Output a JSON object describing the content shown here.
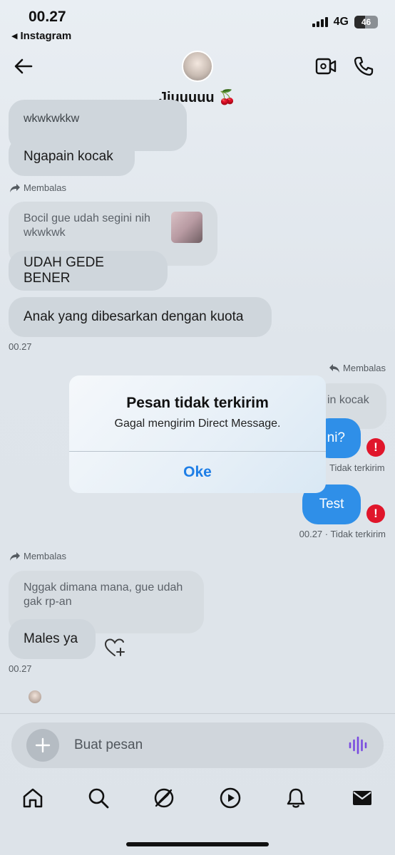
{
  "status_bar": {
    "time": "00.27",
    "back_app": "Instagram",
    "network": "4G",
    "battery": "46",
    "battery_level": 0.46
  },
  "header": {
    "contact_name": "Jiuuuuu 🍒",
    "icons": [
      "back-arrow-icon",
      "video-call-icon",
      "phone-call-icon"
    ]
  },
  "messages": {
    "m1_text": "wkwkwkkw",
    "m2_text": "Ngapain kocak",
    "reply1_label": "Membalas",
    "m3_quoted": "Bocil gue udah segini nih wkwkwk",
    "m4_text": "UDAH GEDE BENER",
    "m5_text": "Anak yang dibesarkan dengan kuota",
    "ts1": "00.27",
    "reply2_label": "Membalas",
    "out1_quoted": "in kocak",
    "out2_text": "ni?",
    "out2_status": "Tidak terkirim",
    "out3_text": "Test",
    "out3_status": "00.27 · Tidak terkirim",
    "reply3_label": "Membalas",
    "m6_quoted": "Nggak dimana mana, gue udah gak rp-an",
    "m7_text": "Males ya",
    "ts2": "00.27"
  },
  "dialog": {
    "title": "Pesan tidak terkirim",
    "message": "Gagal mengirim Direct Message.",
    "button": "Oke"
  },
  "composer": {
    "placeholder": "Buat pesan"
  },
  "colors": {
    "outgoing_bubble": "#2f8fe8",
    "incoming_bubble": "#cfd6dc",
    "error": "#e0162b",
    "dialog_button": "#1e7ee6",
    "voice_icon": "#7a4ce0"
  },
  "bottom_nav": [
    "home-icon",
    "search-icon",
    "explore-icon",
    "reels-icon",
    "notifications-icon",
    "messages-icon"
  ]
}
